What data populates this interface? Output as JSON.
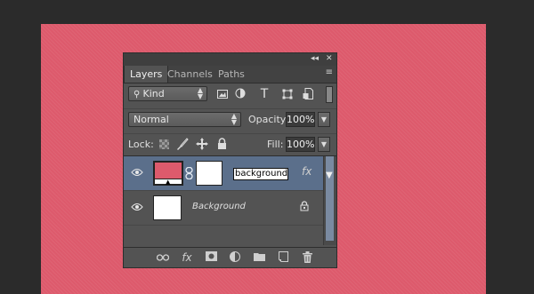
{
  "panel": {
    "top_controls": {
      "collapse_label": "◂◂",
      "close_label": "✕"
    },
    "tabs": [
      {
        "label": "Layers",
        "active": true
      },
      {
        "label": "Channels",
        "active": false
      },
      {
        "label": "Paths",
        "active": false
      }
    ],
    "tab_menu_icon": "≡",
    "filter": {
      "label": "Kind"
    },
    "filter_icons": [
      "image-filter-icon",
      "adjustment-filter-icon",
      "type-filter-icon",
      "shape-filter-icon",
      "smart-object-filter-icon",
      "filter-toggle-icon"
    ],
    "blend_mode": {
      "value": "Normal"
    },
    "opacity": {
      "label": "Opacity:",
      "value": "100%"
    },
    "lock": {
      "label": "Lock:"
    },
    "fill": {
      "label": "Fill:",
      "value": "100%"
    },
    "layers": [
      {
        "name": "background",
        "editing": true,
        "selected": true,
        "thumb_color": "#dd5a6c",
        "fx_label": "fx"
      },
      {
        "name": "Background",
        "editing": false,
        "selected": false,
        "thumb_color": "#ffffff",
        "locked": true
      }
    ],
    "bottom_icons": [
      "link-layers-icon",
      "fx-icon",
      "add-mask-icon",
      "adjustment-layer-icon",
      "new-group-icon",
      "new-layer-icon",
      "delete-icon"
    ],
    "bottom_fx_label": "fx"
  },
  "colors": {
    "canvas": "#dd5a6c",
    "panel": "#535353",
    "selection": "#5b6f8b"
  }
}
